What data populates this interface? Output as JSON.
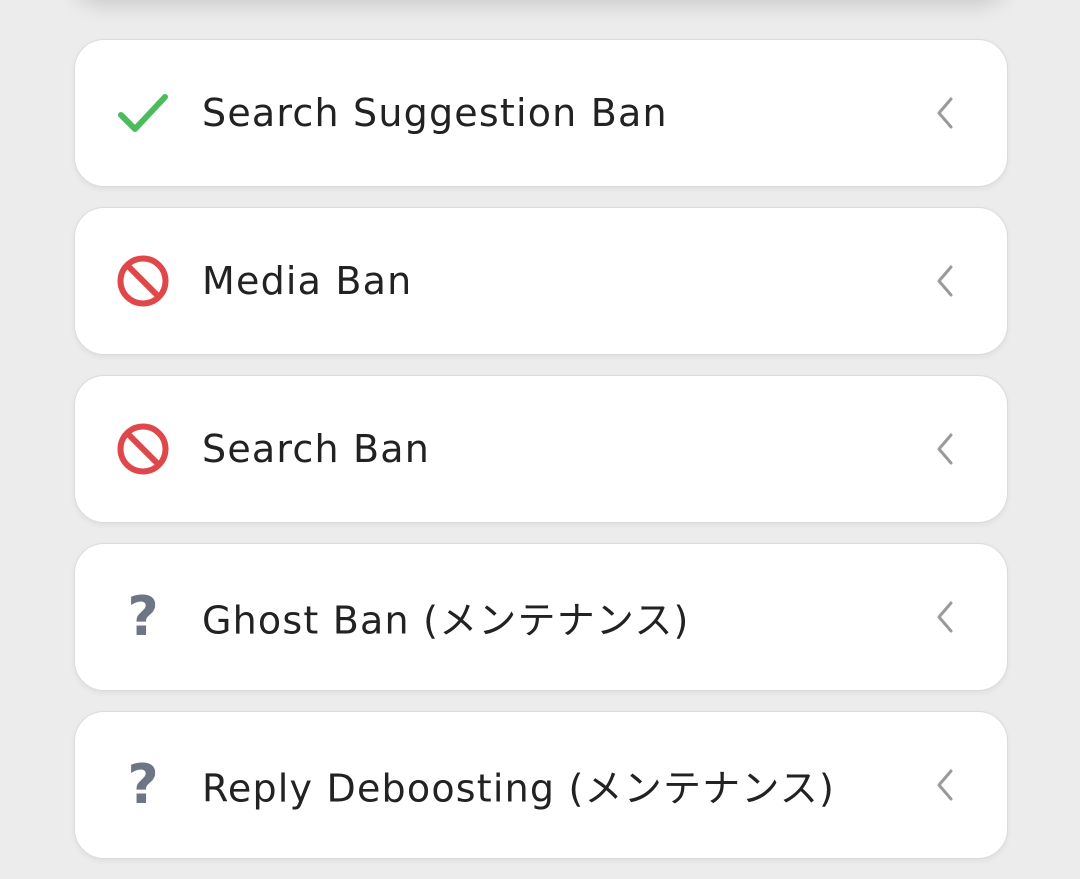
{
  "items": [
    {
      "label": "Search Suggestion Ban",
      "status": "ok",
      "icon": "check-icon",
      "color": "#4cbb5b"
    },
    {
      "label": "Media Ban",
      "status": "banned",
      "icon": "prohibited-icon",
      "color": "#e0474a"
    },
    {
      "label": "Search Ban",
      "status": "banned",
      "icon": "prohibited-icon",
      "color": "#e0474a"
    },
    {
      "label": "Ghost Ban (メンテナンス)",
      "status": "unknown",
      "icon": "question-icon",
      "color": "#6e7686"
    },
    {
      "label": "Reply Deboosting (メンテナンス)",
      "status": "unknown",
      "icon": "question-icon",
      "color": "#6e7686"
    }
  ],
  "colors": {
    "ok": "#4cbb5b",
    "banned": "#e0474a",
    "unknown": "#6e7686",
    "chevron": "#9a9a9a",
    "card_bg": "#ffffff",
    "page_bg": "#ececec"
  }
}
